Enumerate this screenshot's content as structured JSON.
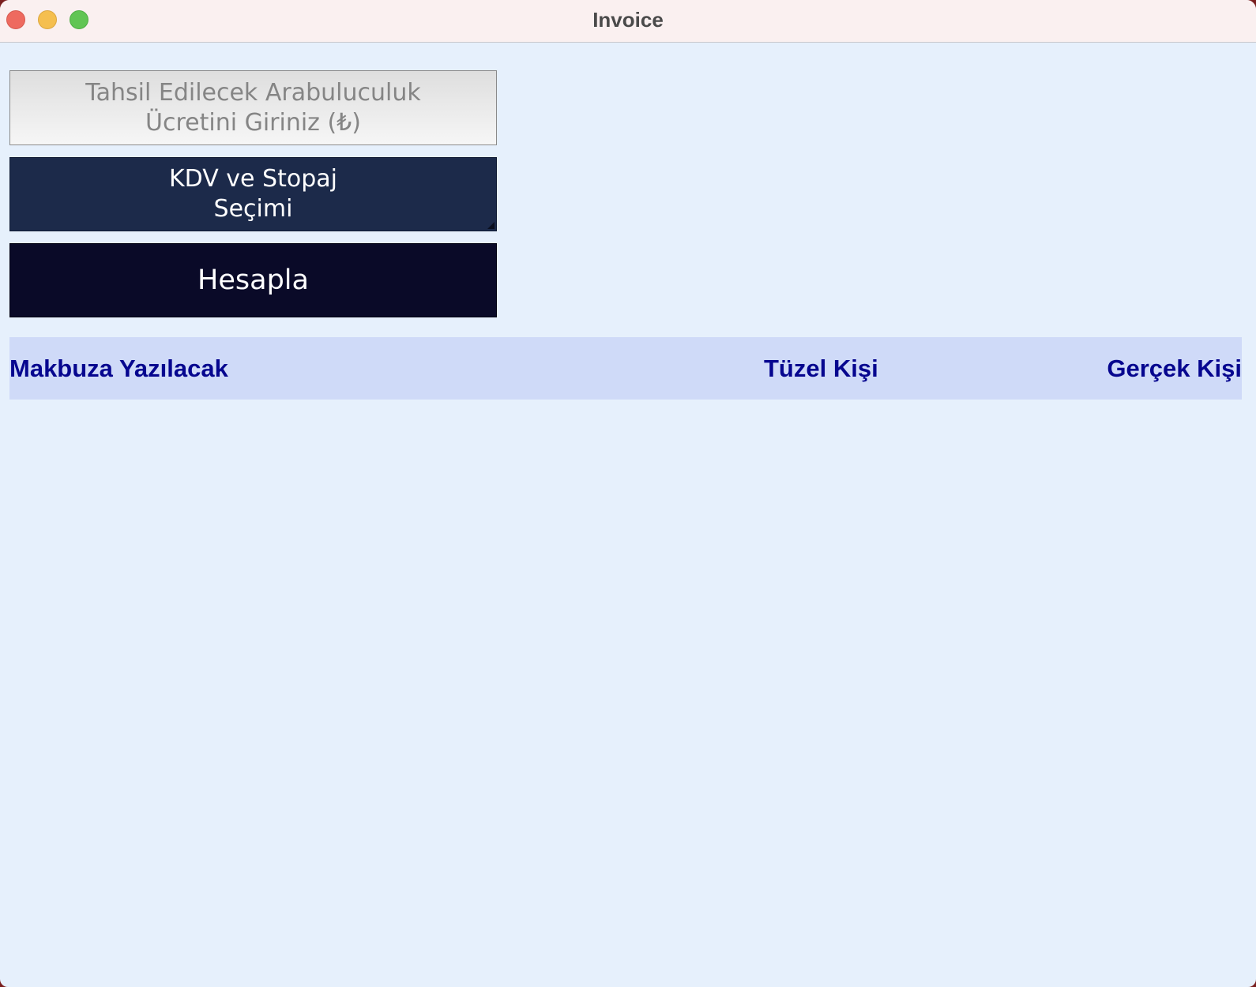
{
  "window": {
    "title": "Invoice"
  },
  "form": {
    "fee_input": {
      "value": "",
      "placeholder": "Tahsil Edilecek Arabuluculuk\nÜcretini Giriniz (₺)"
    },
    "kdv_button_label": "KDV ve Stopaj\nSeçimi",
    "calculate_button_label": "Hesapla"
  },
  "results": {
    "columns": [
      "Makbuza Yazılacak",
      "Tüzel Kişi",
      "Gerçek Kişi"
    ],
    "rows": []
  },
  "colors": {
    "background": "#e6f0fc",
    "titlebar": "#faf0f0",
    "kdv_button": "#1c2a4a",
    "calculate_button": "#0a0a28",
    "header_band": "#cfdaf8",
    "header_text": "#06068f"
  }
}
